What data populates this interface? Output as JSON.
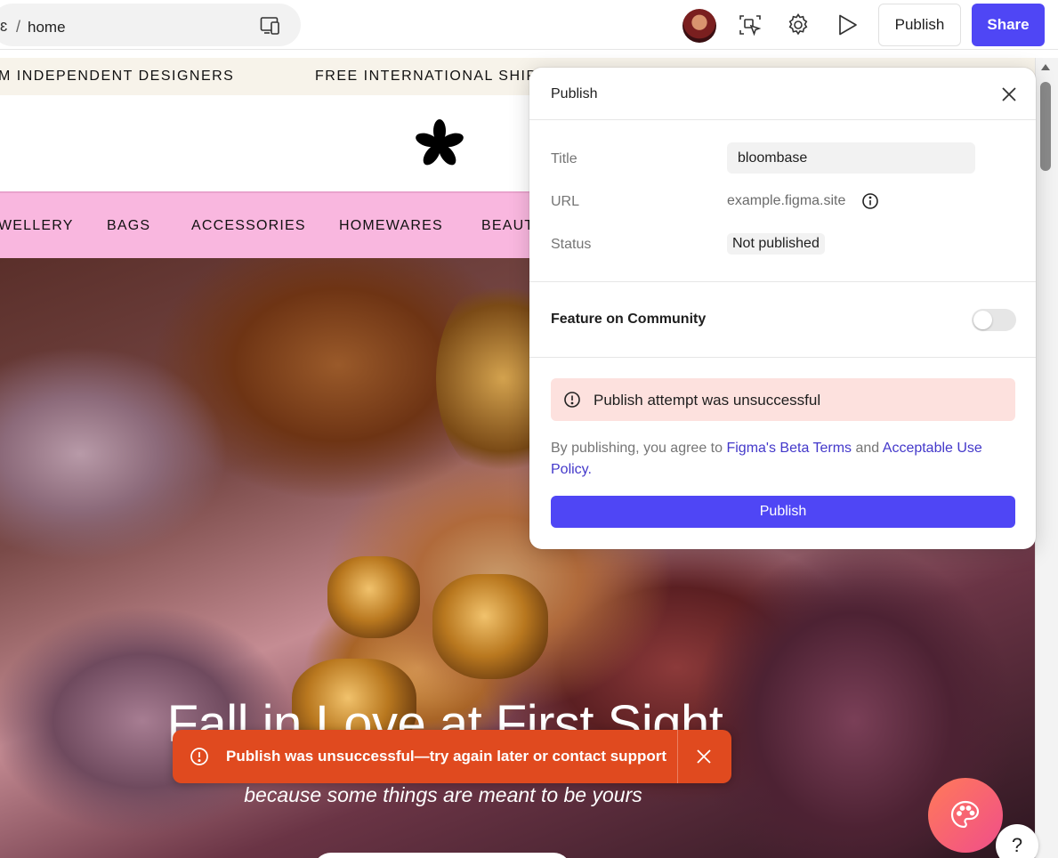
{
  "toolbar": {
    "crumb_edge": "ɛ",
    "separator": "/",
    "page_name": "home",
    "publish_label": "Publish",
    "share_label": "Share",
    "accent_color": "#4f46f5"
  },
  "site": {
    "ticker": [
      "M INDEPENDENT DESIGNERS",
      "FREE INTERNATIONAL SHIPP"
    ],
    "nav": [
      "WELLERY",
      "BAGS",
      "ACCESSORIES",
      "HOMEWARES",
      "BEAUT"
    ],
    "nav_color": "#f9b7df",
    "hero_title": "Fall in Love at First Sight",
    "hero_subtitle": "because some things are meant to be yours"
  },
  "publish_panel": {
    "title": "Publish",
    "fields": {
      "title_label": "Title",
      "title_value": "bloombase",
      "url_label": "URL",
      "url_value": "example.figma.site",
      "status_label": "Status",
      "status_value": "Not published"
    },
    "feature_label": "Feature on Community",
    "feature_enabled": false,
    "error_message": "Publish attempt was unsuccessful",
    "terms": {
      "prefix": "By publishing, you agree to",
      "link1": "Figma's Beta Terms",
      "middle": "and",
      "link2": "Acceptable Use Policy",
      "suffix": "."
    },
    "publish_button": "Publish"
  },
  "toast": {
    "message": "Publish was unsuccessful—try again later or contact support",
    "color": "#e04a1f"
  },
  "help_label": "?",
  "icons": [
    "device-preview-icon",
    "inspect-icon",
    "gear-icon",
    "play-icon",
    "close-icon",
    "info-icon",
    "alert-icon",
    "palette-icon"
  ]
}
